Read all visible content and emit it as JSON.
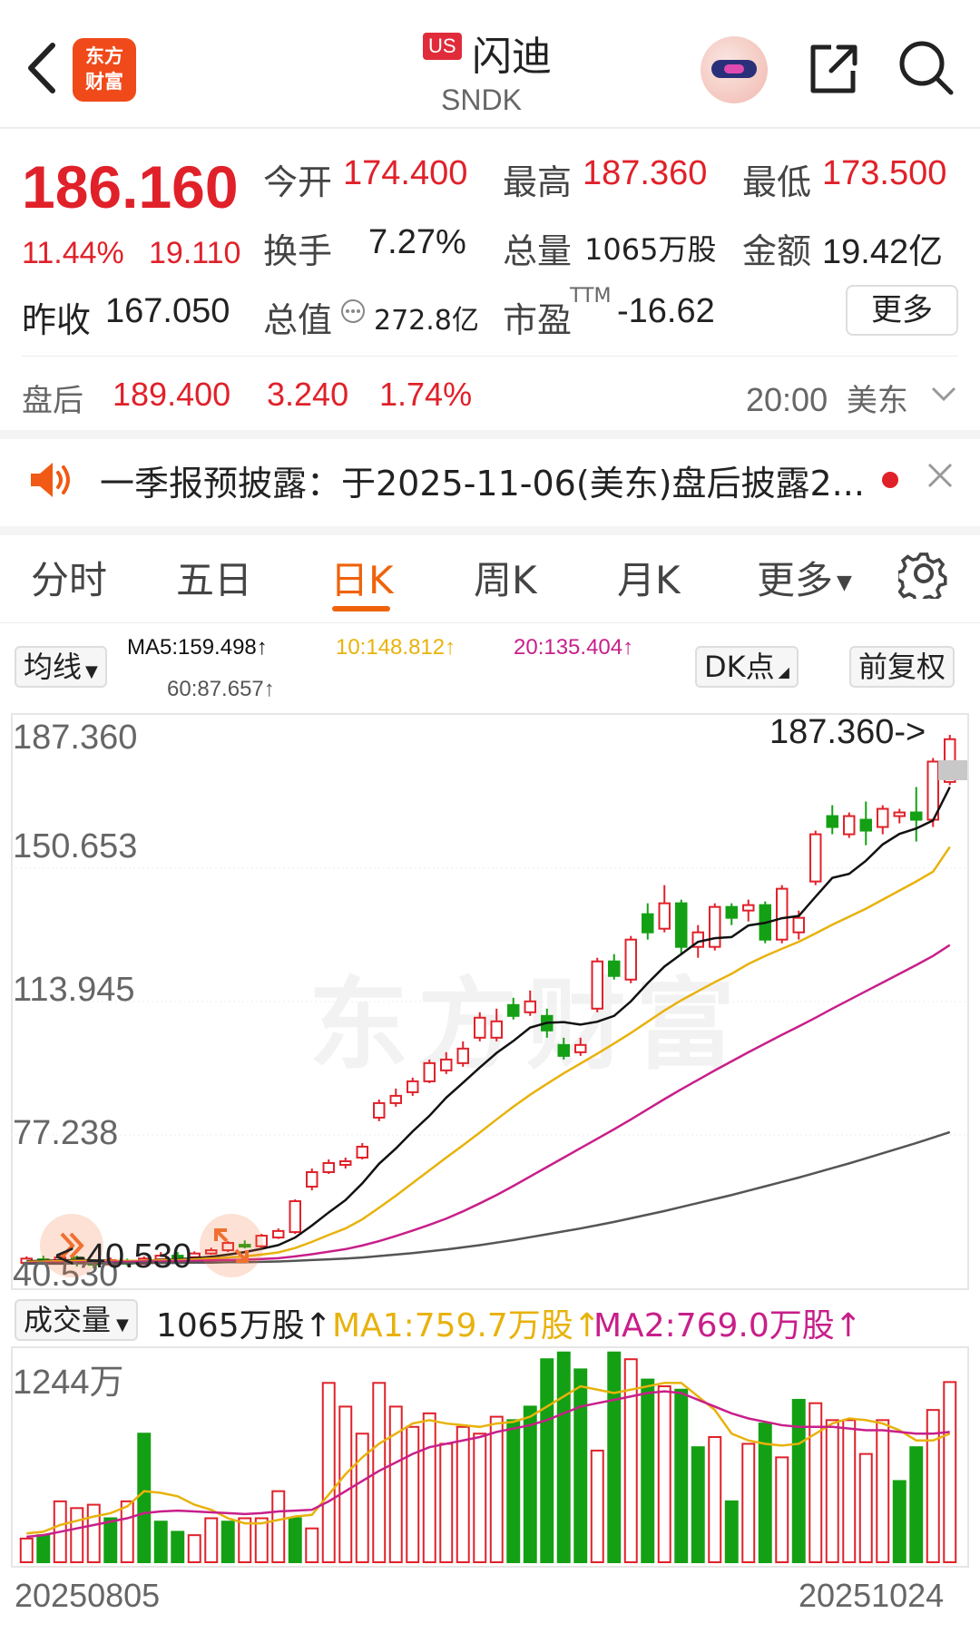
{
  "header": {
    "logo_text_line1": "东方",
    "logo_text_line2": "财富",
    "market_badge": "US",
    "stock_name": "闪迪",
    "ticker": "SNDK"
  },
  "quote": {
    "price": "186.160",
    "change_pct": "11.44%",
    "change_abs": "19.110",
    "open_label": "今开",
    "open": "174.400",
    "high_label": "最高",
    "high": "187.360",
    "low_label": "最低",
    "low": "173.500",
    "turnover_label": "换手",
    "turnover": "7.27%",
    "volume_label": "总量",
    "volume": "1065万股",
    "amount_label": "金额",
    "amount": "19.42亿",
    "prev_close_label": "昨收",
    "prev_close": "167.050",
    "mktcap_label": "总值",
    "mktcap": "272.8亿",
    "pe_label": "市盈",
    "pe_sup": "TTM",
    "pe": "-16.62",
    "more_label": "更多"
  },
  "after_hours": {
    "label": "盘后",
    "price": "189.400",
    "change_abs": "3.240",
    "change_pct": "1.74%",
    "time": "20:00",
    "tz": "美东"
  },
  "notice": {
    "text": "一季报预披露：于2025-11-06(美东)盘后披露2..."
  },
  "tabs": [
    "分时",
    "五日",
    "日K",
    "周K",
    "月K",
    "更多"
  ],
  "active_tab": "日K",
  "chart_controls": {
    "ma_button": "均线",
    "ma5": "MA5:159.498↑",
    "ma10": "10:148.812↑",
    "ma20": "20:135.404↑",
    "ma60": "60:87.657↑",
    "dk_button": "DK点",
    "adjust_button": "前复权",
    "volume_button": "成交量",
    "vol_value": "1065万股↑",
    "vol_ma1": "MA1:759.7万股↑",
    "vol_ma2": "MA2:769.0万股↑"
  },
  "colors": {
    "up": "#e0212a",
    "down": "#14a014",
    "ma5": "#111111",
    "ma10": "#e8b20c",
    "ma20": "#c81f8a",
    "ma60": "#555555",
    "accent": "#f0620a"
  },
  "chart_data": [
    {
      "type": "candlestick",
      "title": "",
      "y_ticks": [
        "187.360",
        "150.653",
        "113.945",
        "77.238",
        "40.530"
      ],
      "ylim": [
        40.53,
        187.36
      ],
      "high_marker": "187.360->",
      "low_marker": "<-40.530",
      "x_labels": [
        "20250805",
        "20251024"
      ],
      "candles": [
        [
          42.0,
          43.2,
          41.2,
          43.8
        ],
        [
          43.0,
          42.0,
          41.5,
          44.0
        ],
        [
          42.0,
          43.5,
          41.8,
          44.2
        ],
        [
          43.5,
          42.2,
          41.0,
          44.0
        ],
        [
          42.0,
          41.6,
          40.53,
          43.0
        ],
        [
          41.6,
          42.8,
          41.2,
          43.5
        ],
        [
          42.6,
          41.8,
          41.2,
          43.2
        ],
        [
          41.8,
          43.2,
          41.6,
          43.8
        ],
        [
          43.0,
          44.0,
          42.6,
          45.0
        ],
        [
          44.0,
          43.5,
          43.0,
          45.0
        ],
        [
          43.6,
          44.6,
          43.3,
          45.2
        ],
        [
          44.6,
          45.5,
          44.2,
          46.2
        ],
        [
          45.5,
          47.5,
          45.0,
          48.0
        ],
        [
          47.0,
          46.6,
          46.0,
          48.2
        ],
        [
          46.6,
          49.5,
          46.2,
          50.0
        ],
        [
          49.0,
          50.8,
          48.6,
          51.5
        ],
        [
          50.5,
          59.0,
          50.0,
          59.5
        ],
        [
          63.0,
          67.0,
          62.0,
          68.0
        ],
        [
          67.0,
          69.5,
          66.5,
          70.5
        ],
        [
          69.0,
          70.0,
          68.0,
          71.0
        ],
        [
          71.0,
          74.0,
          70.5,
          75.0
        ],
        [
          82.0,
          86.0,
          81.0,
          87.0
        ],
        [
          86.0,
          88.0,
          85.0,
          90.0
        ],
        [
          89.0,
          92.0,
          88.0,
          93.0
        ],
        [
          92.0,
          97.0,
          91.5,
          98.0
        ],
        [
          95.0,
          98.0,
          94.0,
          100.0
        ],
        [
          97.0,
          101.0,
          96.0,
          103.0
        ],
        [
          104.0,
          109.5,
          103.0,
          111.0
        ],
        [
          104.0,
          108.5,
          103.0,
          112.0
        ],
        [
          113.0,
          110.0,
          109.0,
          115.0
        ],
        [
          111.0,
          114.0,
          110.0,
          117.0
        ],
        [
          110.0,
          106.0,
          104.0,
          112.0
        ],
        [
          102.0,
          99.0,
          98.0,
          104.0
        ],
        [
          100.0,
          102.0,
          99.0,
          104.0
        ],
        [
          112.0,
          125.0,
          111.0,
          126.0
        ],
        [
          125.0,
          121.0,
          120.0,
          127.0
        ],
        [
          120.0,
          131.0,
          119.0,
          132.0
        ],
        [
          138.0,
          133.0,
          131.0,
          141.0
        ],
        [
          134.0,
          141.0,
          133.0,
          146.0
        ],
        [
          141.0,
          129.0,
          127.0,
          142.0
        ],
        [
          129.0,
          133.0,
          126.0,
          135.0
        ],
        [
          129.0,
          140.0,
          128.0,
          141.0
        ],
        [
          140.0,
          137.0,
          135.0,
          141.0
        ],
        [
          139.0,
          140.5,
          136.0,
          142.0
        ],
        [
          140.5,
          131.0,
          130.0,
          141.5
        ],
        [
          131.0,
          145.0,
          130.0,
          146.0
        ],
        [
          133.0,
          137.0,
          131.0,
          139.0
        ],
        [
          147.0,
          160.0,
          146.0,
          161.0
        ],
        [
          165.0,
          162.0,
          160.0,
          168.0
        ],
        [
          160.0,
          165.0,
          159.0,
          166.0
        ],
        [
          164.0,
          161.0,
          157.0,
          169.0
        ],
        [
          162.0,
          167.0,
          160.0,
          168.0
        ],
        [
          165.0,
          166.0,
          163.0,
          167.0
        ],
        [
          166.0,
          164.0,
          158.0,
          173.0
        ],
        [
          164.0,
          180.0,
          162.0,
          181.0
        ],
        [
          174.4,
          186.16,
          173.5,
          187.36
        ]
      ],
      "ma_series": {
        "MA5": [
          42.5,
          42.6,
          42.7,
          42.8,
          42.7,
          42.6,
          42.5,
          42.6,
          42.8,
          43.0,
          43.3,
          43.7,
          44.3,
          45.0,
          45.9,
          46.9,
          49.0,
          52.3,
          55.9,
          59.3,
          63.9,
          69.3,
          73.5,
          78.2,
          82.5,
          87.5,
          91.6,
          95.8,
          99.8,
          103.1,
          106.8,
          108.1,
          108.3,
          107.6,
          108.4,
          110.0,
          114.0,
          119.0,
          123.6,
          127.0,
          130.4,
          131.4,
          131.7,
          134.9,
          135.6,
          136.9,
          137.5,
          142.8,
          148.0,
          149.1,
          152.7,
          157.2,
          160.1,
          161.6,
          163.8,
          173.0
        ],
        "MA10": [
          42.3,
          42.4,
          42.5,
          42.6,
          42.6,
          42.6,
          42.6,
          42.6,
          42.7,
          42.8,
          43.0,
          43.2,
          43.5,
          43.8,
          44.3,
          44.9,
          46.1,
          47.8,
          49.7,
          51.5,
          54.0,
          57.2,
          60.5,
          64.0,
          67.5,
          71.0,
          74.4,
          77.9,
          81.5,
          85.0,
          88.3,
          91.3,
          94.2,
          96.9,
          99.6,
          102.4,
          105.3,
          108.4,
          111.5,
          114.3,
          116.8,
          119.3,
          121.6,
          124.3,
          126.5,
          128.5,
          130.4,
          132.7,
          135.1,
          137.3,
          139.5,
          142.0,
          144.5,
          147.0,
          149.7,
          156.5
        ],
        "MA20": [
          42.0,
          42.1,
          42.1,
          42.2,
          42.2,
          42.3,
          42.3,
          42.4,
          42.4,
          42.5,
          42.6,
          42.7,
          42.8,
          42.9,
          43.1,
          43.3,
          43.8,
          44.4,
          45.1,
          45.8,
          46.8,
          48.0,
          49.4,
          50.9,
          52.5,
          54.2,
          56.2,
          58.4,
          60.7,
          63.2,
          65.8,
          68.4,
          71.0,
          73.6,
          76.2,
          78.8,
          81.5,
          84.3,
          87.1,
          89.8,
          92.4,
          95.0,
          97.5,
          100.0,
          102.4,
          104.8,
          107.1,
          109.5,
          112.0,
          114.4,
          116.8,
          119.2,
          121.6,
          124.0,
          126.5,
          129.5
        ],
        "MA60": [
          41.8,
          41.8,
          41.8,
          41.9,
          41.9,
          41.9,
          41.9,
          42.0,
          42.0,
          42.0,
          42.1,
          42.1,
          42.2,
          42.2,
          42.3,
          42.4,
          42.6,
          42.8,
          43.0,
          43.2,
          43.5,
          43.9,
          44.3,
          44.7,
          45.2,
          45.7,
          46.3,
          46.9,
          47.6,
          48.3,
          49.1,
          49.9,
          50.7,
          51.5,
          52.4,
          53.3,
          54.3,
          55.3,
          56.3,
          57.4,
          58.5,
          59.6,
          60.7,
          61.9,
          63.1,
          64.3,
          65.5,
          66.8,
          68.1,
          69.4,
          70.8,
          72.2,
          73.6,
          75.0,
          76.5,
          78.0
        ]
      }
    },
    {
      "type": "bar",
      "title": "成交量",
      "y_ticks": [
        "1244万"
      ],
      "ylim": [
        0,
        1244
      ],
      "unit": "万股",
      "values": [
        140,
        160,
        360,
        320,
        340,
        260,
        360,
        760,
        240,
        180,
        160,
        260,
        240,
        260,
        260,
        420,
        260,
        200,
        1060,
        920,
        760,
        1060,
        920,
        800,
        880,
        700,
        800,
        760,
        860,
        840,
        920,
        1200,
        1240,
        1140,
        660,
        1240,
        1200,
        1080,
        1040,
        1020,
        680,
        740,
        360,
        700,
        820,
        620,
        960,
        940,
        840,
        840,
        640,
        840,
        480,
        680,
        900,
        1065
      ],
      "up": [
        true,
        false,
        true,
        true,
        true,
        false,
        true,
        false,
        false,
        false,
        true,
        true,
        false,
        true,
        true,
        true,
        false,
        true,
        true,
        true,
        true,
        true,
        true,
        true,
        true,
        true,
        true,
        true,
        true,
        false,
        false,
        false,
        false,
        false,
        true,
        false,
        true,
        false,
        true,
        false,
        false,
        true,
        false,
        true,
        false,
        true,
        false,
        true,
        true,
        true,
        true,
        true,
        false,
        false,
        true,
        true
      ],
      "ma_series": {
        "MA1": [
          170,
          180,
          220,
          245,
          270,
          290,
          330,
          420,
          410,
          390,
          340,
          310,
          260,
          230,
          230,
          250,
          270,
          280,
          400,
          520,
          620,
          700,
          760,
          820,
          840,
          820,
          810,
          800,
          820,
          830,
          860,
          920,
          980,
          1040,
          1020,
          1000,
          1020,
          1040,
          1060,
          1060,
          980,
          900,
          760,
          720,
          700,
          690,
          700,
          760,
          820,
          850,
          840,
          820,
          780,
          720,
          720,
          760
        ],
        "MA2": [
          150,
          160,
          180,
          200,
          220,
          240,
          260,
          290,
          300,
          305,
          300,
          295,
          290,
          285,
          290,
          300,
          305,
          310,
          360,
          420,
          480,
          540,
          590,
          640,
          680,
          700,
          720,
          740,
          770,
          790,
          810,
          840,
          880,
          920,
          940,
          960,
          980,
          1000,
          1010,
          1000,
          960,
          920,
          880,
          850,
          830,
          810,
          800,
          800,
          800,
          790,
          780,
          780,
          770,
          760,
          760,
          770
        ]
      }
    }
  ]
}
